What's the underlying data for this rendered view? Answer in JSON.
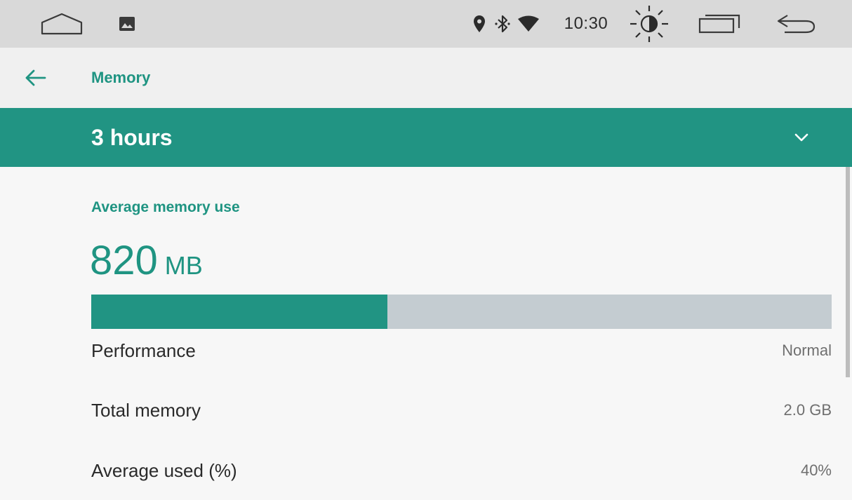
{
  "status_bar": {
    "home_icon": "home-outline-icon",
    "gallery_icon": "image-icon",
    "location_icon": "location-pin-icon",
    "bluetooth_icon": "bluetooth-icon",
    "wifi_icon": "wifi-icon",
    "time": "10:30",
    "brightness_icon": "brightness-icon",
    "recents_icon": "recent-apps-icon",
    "back_icon": "back-arrow-icon"
  },
  "app_bar": {
    "title": "Memory",
    "back_icon": "arrow-left-icon"
  },
  "period_selector": {
    "selected": "3 hours",
    "dropdown_icon": "chevron-down-icon"
  },
  "average_memory": {
    "label": "Average memory use",
    "value": "820",
    "unit": "MB",
    "bar_fill_fraction": 0.4
  },
  "stats": [
    {
      "label": "Performance",
      "value": "Normal"
    },
    {
      "label": "Total memory",
      "value": "2.0 GB"
    },
    {
      "label": "Average used (%)",
      "value": "40%"
    }
  ],
  "colors": {
    "accent": "#219483",
    "accent_text": "#1f9482",
    "bar_track": "#c4ccd1",
    "status_bar": "#d9d9d9"
  }
}
